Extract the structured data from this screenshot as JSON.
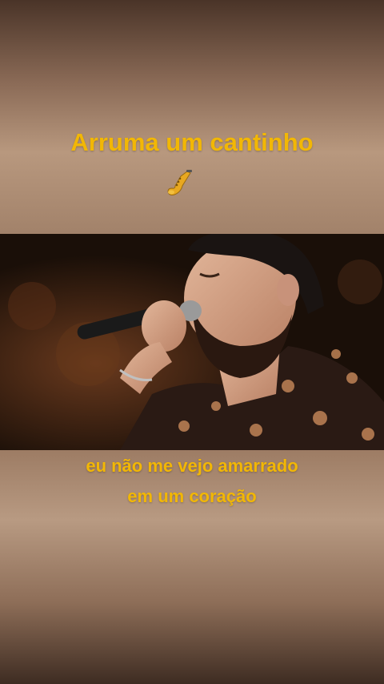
{
  "top_caption": {
    "title": "Arruma um cantinho",
    "emoji_icon": "saxophone-icon"
  },
  "video": {
    "subject": "singer-with-microphone"
  },
  "lyrics": {
    "line1": "eu não me vejo amarrado",
    "line2": "em um coração"
  },
  "colors": {
    "caption_text": "#f2b705"
  }
}
